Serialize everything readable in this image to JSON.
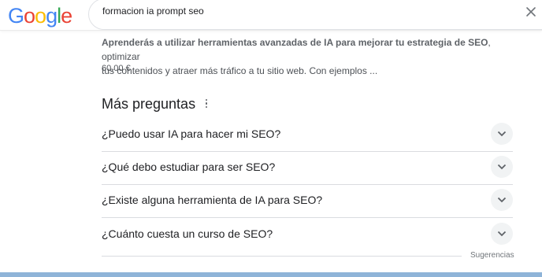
{
  "header": {
    "logo_letters": [
      "G",
      "o",
      "o",
      "g",
      "l",
      "e"
    ],
    "search_query": "formacion ia prompt seo"
  },
  "result": {
    "snippet_bold": "Aprenderás a utilizar herramientas avanzadas de IA para mejorar tu estrategia de SEO",
    "snippet_rest_1": ", optimizar",
    "snippet_line_2": "tus contenidos y atraer más tráfico a tu sitio web. Con ejemplos ...",
    "price": "60,00 €"
  },
  "paa": {
    "title": "Más preguntas",
    "questions": [
      "¿Puedo usar IA para hacer mi SEO?",
      "¿Qué debo estudiar para ser SEO?",
      "¿Existe alguna herramienta de IA para SEO?",
      "¿Cuánto cuesta un curso de SEO?"
    ],
    "feedback_label": "Sugerencias"
  },
  "colors": {
    "accent_blue": "#4285F4",
    "link": "#1a0dab",
    "divider": "#dadce0"
  }
}
